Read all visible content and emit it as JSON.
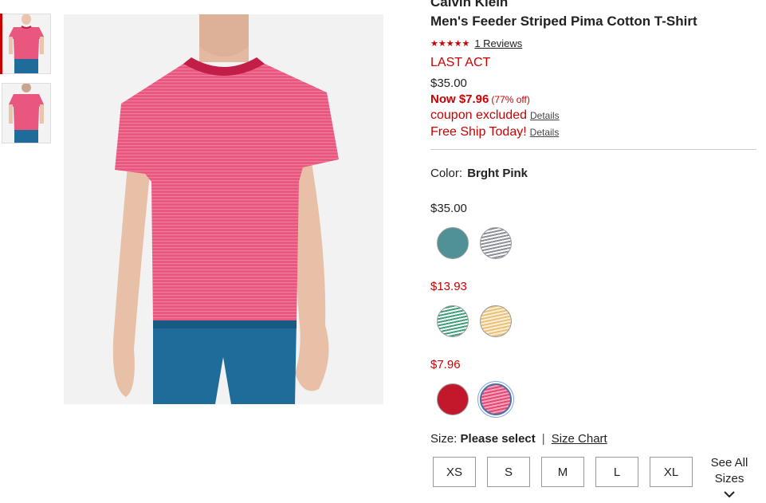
{
  "product": {
    "brand": "Calvin Klein",
    "title": "Men's Feeder Striped Pima Cotton T-Shirt",
    "stars": "★★★★★",
    "reviews_label": "1 Reviews",
    "badge": "LAST ACT",
    "original_price": "$35.00",
    "now_price": "Now $7.96",
    "discount": "(77% off)",
    "coupon_text": "coupon excluded",
    "free_ship_text": "Free Ship Today!",
    "details_label": "Details"
  },
  "color": {
    "label": "Color:",
    "selected": "Brght Pink"
  },
  "swatch_groups": [
    {
      "price": "$35.00",
      "price_color": "#222222",
      "swatches": [
        {
          "name": "teal",
          "color": "#4f9196",
          "striped": false
        },
        {
          "name": "grey-stripe",
          "color": "#8a8f99",
          "striped": true,
          "stripe": "#ffffff"
        }
      ]
    },
    {
      "price": "$13.93",
      "price_color": "#cc0000",
      "swatches": [
        {
          "name": "green-stripe",
          "color": "#3e9f7a",
          "striped": true,
          "stripe": "#ffffff"
        },
        {
          "name": "gold-stripe",
          "color": "#e8c27a",
          "striped": true,
          "stripe": "#fbefd6"
        }
      ]
    },
    {
      "price": "$7.96",
      "price_color": "#cc0000",
      "swatches": [
        {
          "name": "red",
          "color": "#c3182c",
          "striped": false
        },
        {
          "name": "bright-pink",
          "color": "#e24a74",
          "striped": true,
          "stripe": "#f7a3bb",
          "selected": true
        }
      ]
    }
  ],
  "size": {
    "label": "Size:",
    "value": "Please select",
    "separator": "|",
    "chart_label": "Size Chart",
    "options": [
      "XS",
      "S",
      "M",
      "L",
      "XL"
    ],
    "see_all_line1": "See All",
    "see_all_line2": "Sizes"
  },
  "colors": {
    "accent_red": "#cc0000",
    "shirt_pink": "#e9577f",
    "pants_blue": "#1f6b9a"
  }
}
